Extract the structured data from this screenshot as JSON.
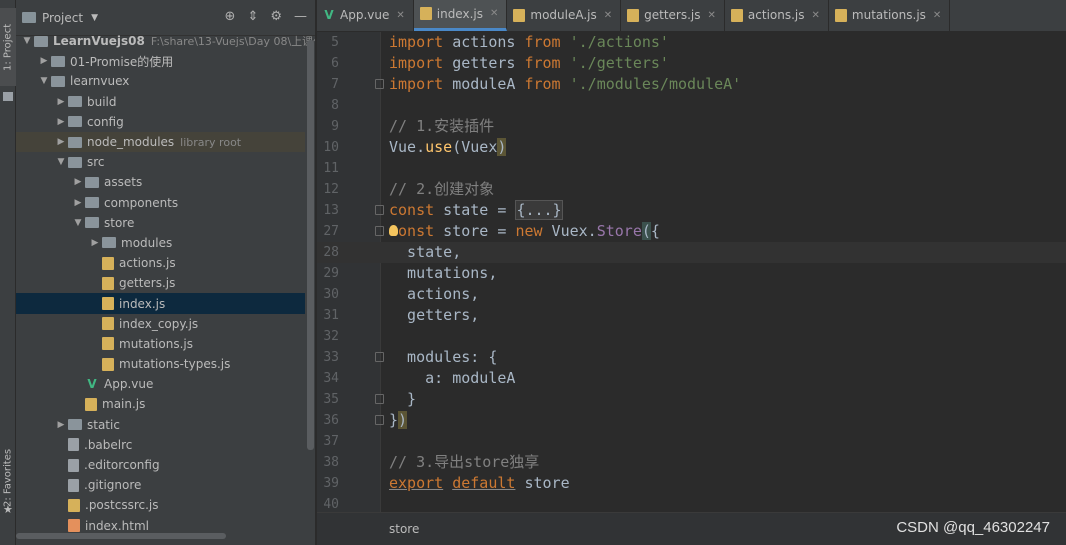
{
  "tool_strip": {
    "project_tab": "1: Project",
    "favorites_tab": "2: Favorites"
  },
  "project_panel": {
    "title": "Project",
    "tree": [
      {
        "name": "LearnVuejs08",
        "hint": "F:\\share\\13-Vuejs\\Day 08\\上课代",
        "type": "folder",
        "depth": 0,
        "expanded": true,
        "bold": true
      },
      {
        "name": "01-Promise的使用",
        "type": "folder",
        "depth": 1,
        "expanded": false
      },
      {
        "name": "learnvuex",
        "type": "folder",
        "depth": 1,
        "expanded": true
      },
      {
        "name": "build",
        "type": "folder",
        "depth": 2,
        "expanded": false
      },
      {
        "name": "config",
        "type": "folder",
        "depth": 2,
        "expanded": false
      },
      {
        "name": "node_modules",
        "hint": "library root",
        "type": "folder",
        "depth": 2,
        "expanded": false,
        "libroot": true
      },
      {
        "name": "src",
        "type": "folder",
        "depth": 2,
        "expanded": true
      },
      {
        "name": "assets",
        "type": "folder",
        "depth": 3,
        "expanded": false
      },
      {
        "name": "components",
        "type": "folder",
        "depth": 3,
        "expanded": false
      },
      {
        "name": "store",
        "type": "folder",
        "depth": 3,
        "expanded": true
      },
      {
        "name": "modules",
        "type": "folder",
        "depth": 4,
        "expanded": false
      },
      {
        "name": "actions.js",
        "type": "js",
        "depth": 4
      },
      {
        "name": "getters.js",
        "type": "js",
        "depth": 4
      },
      {
        "name": "index.js",
        "type": "js",
        "depth": 4,
        "selected": true
      },
      {
        "name": "index_copy.js",
        "type": "js",
        "depth": 4
      },
      {
        "name": "mutations.js",
        "type": "js",
        "depth": 4
      },
      {
        "name": "mutations-types.js",
        "type": "js",
        "depth": 4
      },
      {
        "name": "App.vue",
        "type": "vue",
        "depth": 3
      },
      {
        "name": "main.js",
        "type": "js",
        "depth": 3
      },
      {
        "name": "static",
        "type": "folder",
        "depth": 2,
        "expanded": false
      },
      {
        "name": ".babelrc",
        "type": "cfg",
        "depth": 2
      },
      {
        "name": ".editorconfig",
        "type": "cfg",
        "depth": 2
      },
      {
        "name": ".gitignore",
        "type": "cfg",
        "depth": 2
      },
      {
        "name": ".postcssrc.js",
        "type": "js",
        "depth": 2
      },
      {
        "name": "index.html",
        "type": "html",
        "depth": 2
      }
    ]
  },
  "tabs": [
    {
      "label": "App.vue",
      "type": "vue",
      "active": false
    },
    {
      "label": "index.js",
      "type": "js",
      "active": true
    },
    {
      "label": "moduleA.js",
      "type": "js",
      "active": false
    },
    {
      "label": "getters.js",
      "type": "js",
      "active": false
    },
    {
      "label": "actions.js",
      "type": "js",
      "active": false
    },
    {
      "label": "mutations.js",
      "type": "js",
      "active": false
    }
  ],
  "editor": {
    "current_line": 28,
    "lines": [
      {
        "n": "5",
        "tokens": [
          [
            "kw",
            "import"
          ],
          [
            "p",
            " actions "
          ],
          [
            "kw",
            "from"
          ],
          [
            "p",
            " "
          ],
          [
            "str",
            "'./actions'"
          ]
        ]
      },
      {
        "n": "6",
        "tokens": [
          [
            "kw",
            "import"
          ],
          [
            "p",
            " getters "
          ],
          [
            "kw",
            "from"
          ],
          [
            "p",
            " "
          ],
          [
            "str",
            "'./getters'"
          ]
        ]
      },
      {
        "n": "7",
        "fold": true,
        "tokens": [
          [
            "kw",
            "import"
          ],
          [
            "p",
            " moduleA "
          ],
          [
            "kw",
            "from"
          ],
          [
            "p",
            " "
          ],
          [
            "str",
            "'./modules/moduleA'"
          ]
        ]
      },
      {
        "n": "8",
        "tokens": []
      },
      {
        "n": "9",
        "tokens": [
          [
            "cm",
            "// 1.安装插件"
          ]
        ]
      },
      {
        "n": "10",
        "tokens": [
          [
            "p",
            "Vue."
          ],
          [
            "fn",
            "use"
          ],
          [
            "p",
            "(Vuex"
          ],
          [
            "brk2",
            ")"
          ]
        ]
      },
      {
        "n": "11",
        "tokens": []
      },
      {
        "n": "12",
        "tokens": [
          [
            "cm",
            "// 2.创建对象"
          ]
        ]
      },
      {
        "n": "13",
        "fold": true,
        "tokens": [
          [
            "kw",
            "const"
          ],
          [
            "p",
            " state = "
          ],
          [
            "folded",
            "{...}"
          ]
        ]
      },
      {
        "n": "27",
        "fold": true,
        "bulb": true,
        "tokens": [
          [
            "kw",
            "const"
          ],
          [
            "p",
            " store = "
          ],
          [
            "kw",
            "new"
          ],
          [
            "p",
            " Vuex."
          ],
          [
            "prop",
            "Store"
          ],
          [
            "brk",
            "("
          ],
          [
            "p",
            "{"
          ]
        ]
      },
      {
        "n": "28",
        "tokens": [
          [
            "p",
            "  state,"
          ]
        ]
      },
      {
        "n": "29",
        "tokens": [
          [
            "p",
            "  mutations,"
          ]
        ]
      },
      {
        "n": "30",
        "tokens": [
          [
            "p",
            "  actions,"
          ]
        ]
      },
      {
        "n": "31",
        "tokens": [
          [
            "p",
            "  getters,"
          ]
        ]
      },
      {
        "n": "32",
        "tokens": []
      },
      {
        "n": "33",
        "fold": true,
        "tokens": [
          [
            "p",
            "  modules: {"
          ]
        ]
      },
      {
        "n": "34",
        "tokens": [
          [
            "p",
            "    a: moduleA"
          ]
        ]
      },
      {
        "n": "35",
        "fold": true,
        "tokens": [
          [
            "p",
            "  }"
          ]
        ]
      },
      {
        "n": "36",
        "fold": true,
        "tokens": [
          [
            "p",
            "}"
          ],
          [
            "brk2",
            ")"
          ]
        ]
      },
      {
        "n": "37",
        "tokens": []
      },
      {
        "n": "38",
        "tokens": [
          [
            "cm",
            "// 3.导出store独享"
          ]
        ]
      },
      {
        "n": "39",
        "tokens": [
          [
            "kwu",
            "export"
          ],
          [
            "p",
            " "
          ],
          [
            "kwu",
            "default"
          ],
          [
            "p",
            " store"
          ]
        ]
      },
      {
        "n": "40",
        "tokens": []
      }
    ]
  },
  "breadcrumb": "store",
  "watermark": "CSDN @qq_46302247"
}
